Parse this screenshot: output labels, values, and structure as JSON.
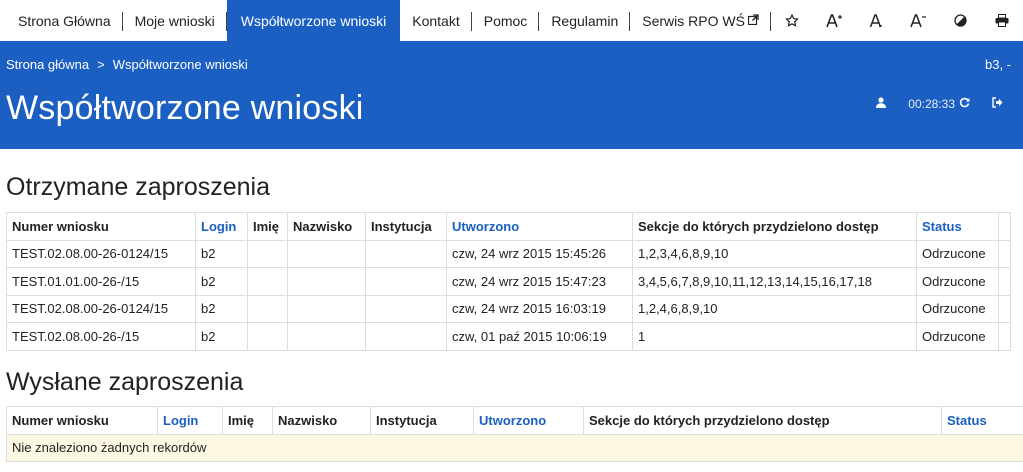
{
  "nav": {
    "items": [
      {
        "label": "Strona Główna",
        "active": false
      },
      {
        "label": "Moje wnioski",
        "active": false
      },
      {
        "label": "Współtworzone wnioski",
        "active": true
      },
      {
        "label": "Kontakt",
        "active": false
      },
      {
        "label": "Pomoc",
        "active": false
      },
      {
        "label": "Regulamin",
        "active": false
      },
      {
        "label": "Serwis RPO WŚ",
        "active": false,
        "external": true
      }
    ],
    "tools": [
      "high-contrast-star-icon",
      "font-larger-icon",
      "font-normal-icon",
      "font-smaller-icon",
      "contrast-icon",
      "print-icon"
    ]
  },
  "header": {
    "breadcrumb": [
      "Strona główna",
      ">",
      "Współtworzone wnioski"
    ],
    "user_code": "b3, -",
    "title": "Współtworzone wnioski",
    "timer": "00:28:33"
  },
  "received": {
    "title": "Otrzymane zaproszenia",
    "columns": [
      "Numer wniosku",
      "Login",
      "Imię",
      "Nazwisko",
      "Instytucja",
      "Utworzono",
      "Sekcje do których przydzielono dostęp",
      "Status"
    ],
    "rows": [
      [
        "TEST.02.08.00-26-0124/15",
        "b2",
        "",
        "",
        "",
        "czw, 24 wrz 2015 15:45:26",
        "1,2,3,4,6,8,9,10",
        "Odrzucone"
      ],
      [
        "TEST.01.01.00-26-/15",
        "b2",
        "",
        "",
        "",
        "czw, 24 wrz 2015 15:47:23",
        "3,4,5,6,7,8,9,10,11,12,13,14,15,16,17,18",
        "Odrzucone"
      ],
      [
        "TEST.02.08.00-26-0124/15",
        "b2",
        "",
        "",
        "",
        "czw, 24 wrz 2015 16:03:19",
        "1,2,4,6,8,9,10",
        "Odrzucone"
      ],
      [
        "TEST.02.08.00-26-/15",
        "b2",
        "",
        "",
        "",
        "czw, 01 paź 2015 10:06:19",
        "1",
        "Odrzucone"
      ]
    ]
  },
  "sent": {
    "title": "Wysłane zaproszenia",
    "columns": [
      "Numer wniosku",
      "Login",
      "Imię",
      "Nazwisko",
      "Instytucja",
      "Utworzono",
      "Sekcje do których przydzielono dostęp",
      "Status"
    ],
    "empty_message": "Nie znaleziono żadnych rekordów"
  },
  "colors": {
    "brand_blue": "#1a5fc1",
    "empty_row_bg": "#fcf8e3"
  }
}
